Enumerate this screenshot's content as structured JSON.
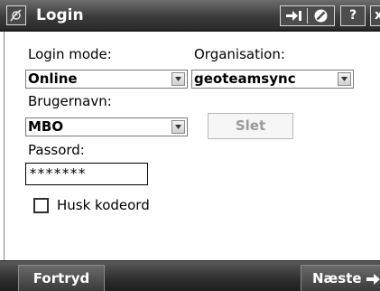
{
  "window": {
    "title": "Login",
    "help_label": "?",
    "close_label": "x"
  },
  "form": {
    "login_mode_label": "Login mode:",
    "login_mode_value": "Online",
    "organisation_label": "Organisation:",
    "organisation_value": "geoteamsync",
    "username_label": "Brugernavn:",
    "username_value": "MBO",
    "delete_label": "Slet",
    "password_label": "Passord:",
    "password_value": "*******",
    "remember_label": "Husk kodeord",
    "remember_checked": false
  },
  "footer": {
    "cancel_label": "Fortryd",
    "next_label": "Næste"
  }
}
